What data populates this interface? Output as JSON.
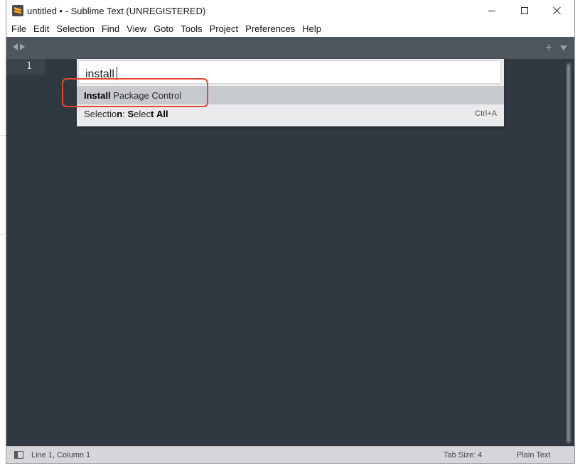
{
  "window": {
    "title": "untitled • - Sublime Text (UNREGISTERED)"
  },
  "menu": [
    "File",
    "Edit",
    "Selection",
    "Find",
    "View",
    "Goto",
    "Tools",
    "Project",
    "Preferences",
    "Help"
  ],
  "tabbar": {
    "plus_label": "+"
  },
  "editor": {
    "line_number": "1"
  },
  "command_palette": {
    "query": "install",
    "results": [
      {
        "segments": [
          {
            "text": "Install",
            "bold": true
          },
          {
            "text": " Package Control",
            "bold": false
          }
        ],
        "shortcut": "",
        "selected": true
      },
      {
        "segments": [
          {
            "text": "Selecti",
            "bold": false
          },
          {
            "text": "o",
            "bold": false
          },
          {
            "text": "n",
            "bold": true
          },
          {
            "text": ": ",
            "bold": false
          },
          {
            "text": "S",
            "bold": true
          },
          {
            "text": "elec",
            "bold": false
          },
          {
            "text": "t",
            "bold": true
          },
          {
            "text": " ",
            "bold": false
          },
          {
            "text": "All",
            "bold": true
          }
        ],
        "shortcut": "Ctrl+A",
        "selected": false
      }
    ]
  },
  "statusbar": {
    "position": "Line 1, Column 1",
    "tab_size": "Tab Size: 4",
    "syntax": "Plain Text"
  },
  "colors": {
    "editor_bg": "#303841",
    "tabbar_bg": "#50565e",
    "palette_bg": "#e9eaec",
    "selected_row_bg": "#c6c9ce",
    "annotation_red": "#e8472e",
    "statusbar_bg": "#d4d6d9"
  }
}
